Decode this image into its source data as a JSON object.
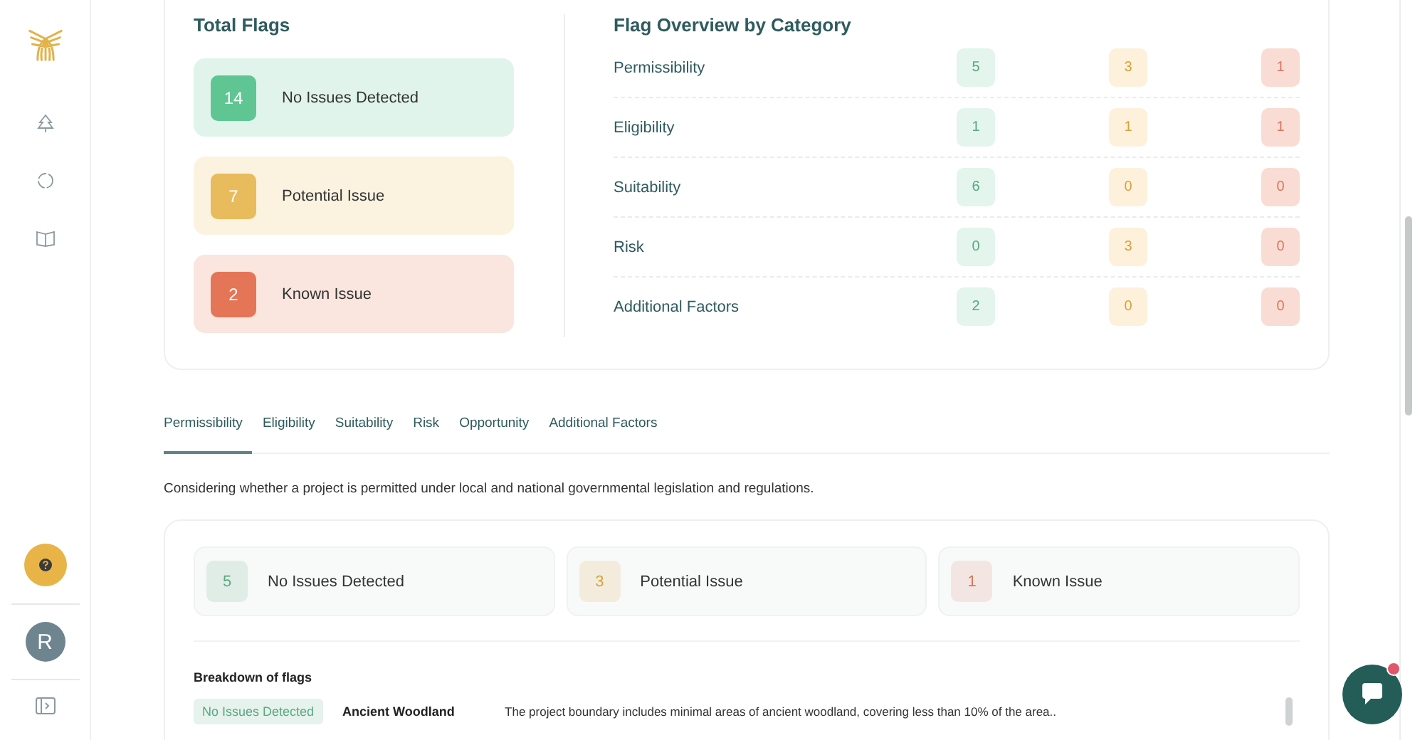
{
  "sidebar": {
    "nav": [
      {
        "kind": "tree"
      },
      {
        "kind": "cycle"
      },
      {
        "kind": "book"
      }
    ],
    "help": {
      "kind": "help"
    },
    "avatar": {
      "initial": "R"
    }
  },
  "total_flags": {
    "title": "Total Flags",
    "items": [
      {
        "color": "#5fc693",
        "count": "14",
        "label": "No Issues Detected"
      },
      {
        "color": "#e8bb5c",
        "count": "7",
        "label": "Potential Issue"
      },
      {
        "color": "#e57557",
        "count": "2",
        "label": "Known Issue"
      }
    ]
  },
  "overview": {
    "title": "Flag Overview by Category",
    "rows": [
      {
        "category": "Permissibility",
        "ok": "5",
        "warn": "3",
        "bad": "1"
      },
      {
        "category": "Eligibility",
        "ok": "1",
        "warn": "1",
        "bad": "1"
      },
      {
        "category": "Suitability",
        "ok": "6",
        "warn": "0",
        "bad": "0"
      },
      {
        "category": "Risk",
        "ok": "0",
        "warn": "3",
        "bad": "0"
      },
      {
        "category": "Additional Factors",
        "ok": "2",
        "warn": "0",
        "bad": "0"
      }
    ]
  },
  "tabs": [
    {
      "label": "Permissibility",
      "selected": true
    },
    {
      "label": "Eligibility",
      "selected": false
    },
    {
      "label": "Suitability",
      "selected": false
    },
    {
      "label": "Risk",
      "selected": false
    },
    {
      "label": "Opportunity",
      "selected": false
    },
    {
      "label": "Additional Factors",
      "selected": false
    }
  ],
  "description": "Considering whether a project is permitted under local and national governmental legislation and regulations.",
  "summary": [
    {
      "color": "#5aa882",
      "count": "5",
      "label": "No Issues Detected"
    },
    {
      "color": "#d4a33b",
      "count": "3",
      "label": "Potential Issue"
    },
    {
      "color": "#d9765c",
      "count": "1",
      "label": "Known Issue"
    }
  ],
  "breakdown": {
    "title": "Breakdown of flags",
    "rows": [
      {
        "color": "#5aa882",
        "status": "No Issues Detected",
        "name": "Ancient Woodland",
        "detail": "The project boundary includes minimal areas of ancient woodland, covering less than 10% of the area.."
      }
    ]
  },
  "chat": {
    "unread": true
  }
}
